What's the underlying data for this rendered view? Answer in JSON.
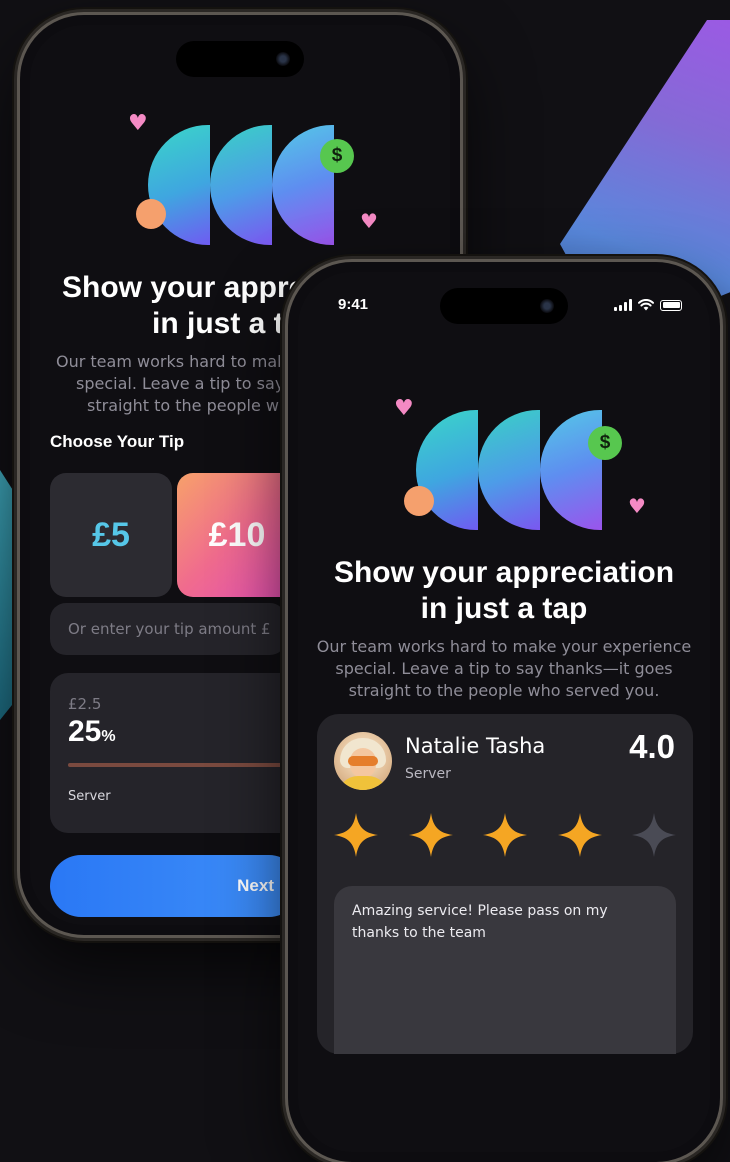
{
  "back_screen": {
    "title_line1": "Show your appre",
    "title_line2": "in just a t",
    "desc_line1": "Our team works hard to mak",
    "desc_line2": "special. Leave a tip to say",
    "desc_line3": "straight to the people wh",
    "choose_label": "Choose Your Tip",
    "tip_options": [
      "£5",
      "£10"
    ],
    "tip_input_placeholder": "Or enter your tip amount £",
    "percent_card": {
      "amount": "£2.5",
      "percent": "25",
      "percent_unit": "%",
      "role": "Server",
      "progress": 0.25
    },
    "next_button": "Next",
    "illustration_icons": [
      "heart-icon",
      "dollar-coin-icon",
      "heart-icon"
    ],
    "dollar_symbol": "$"
  },
  "front_screen": {
    "status_time": "9:41",
    "status_icons": [
      "signal-icon",
      "wifi-icon",
      "battery-icon"
    ],
    "title_line1": "Show your appreciation",
    "title_line2": "in just a tap",
    "desc_line1": "Our team works hard to make your experience",
    "desc_line2": "special. Leave a tip to say thanks—it goes",
    "desc_line3": "straight to the people who served you.",
    "dollar_symbol": "$",
    "review_card": {
      "name": "Natalie Tasha",
      "role": "Server",
      "rating": "4.0",
      "stars_filled": 4,
      "stars_total": 5,
      "comment": "Amazing service! Please pass on my thanks to the team"
    }
  },
  "colors": {
    "background": "#111014",
    "accent_blue": "#2a78f5",
    "star_filled": "#f5a623",
    "star_empty": "#4a4b55",
    "tip_5_text": "#56c7e8",
    "dollar_green": "#57c74f",
    "heart_pink": "#f48ac4"
  }
}
